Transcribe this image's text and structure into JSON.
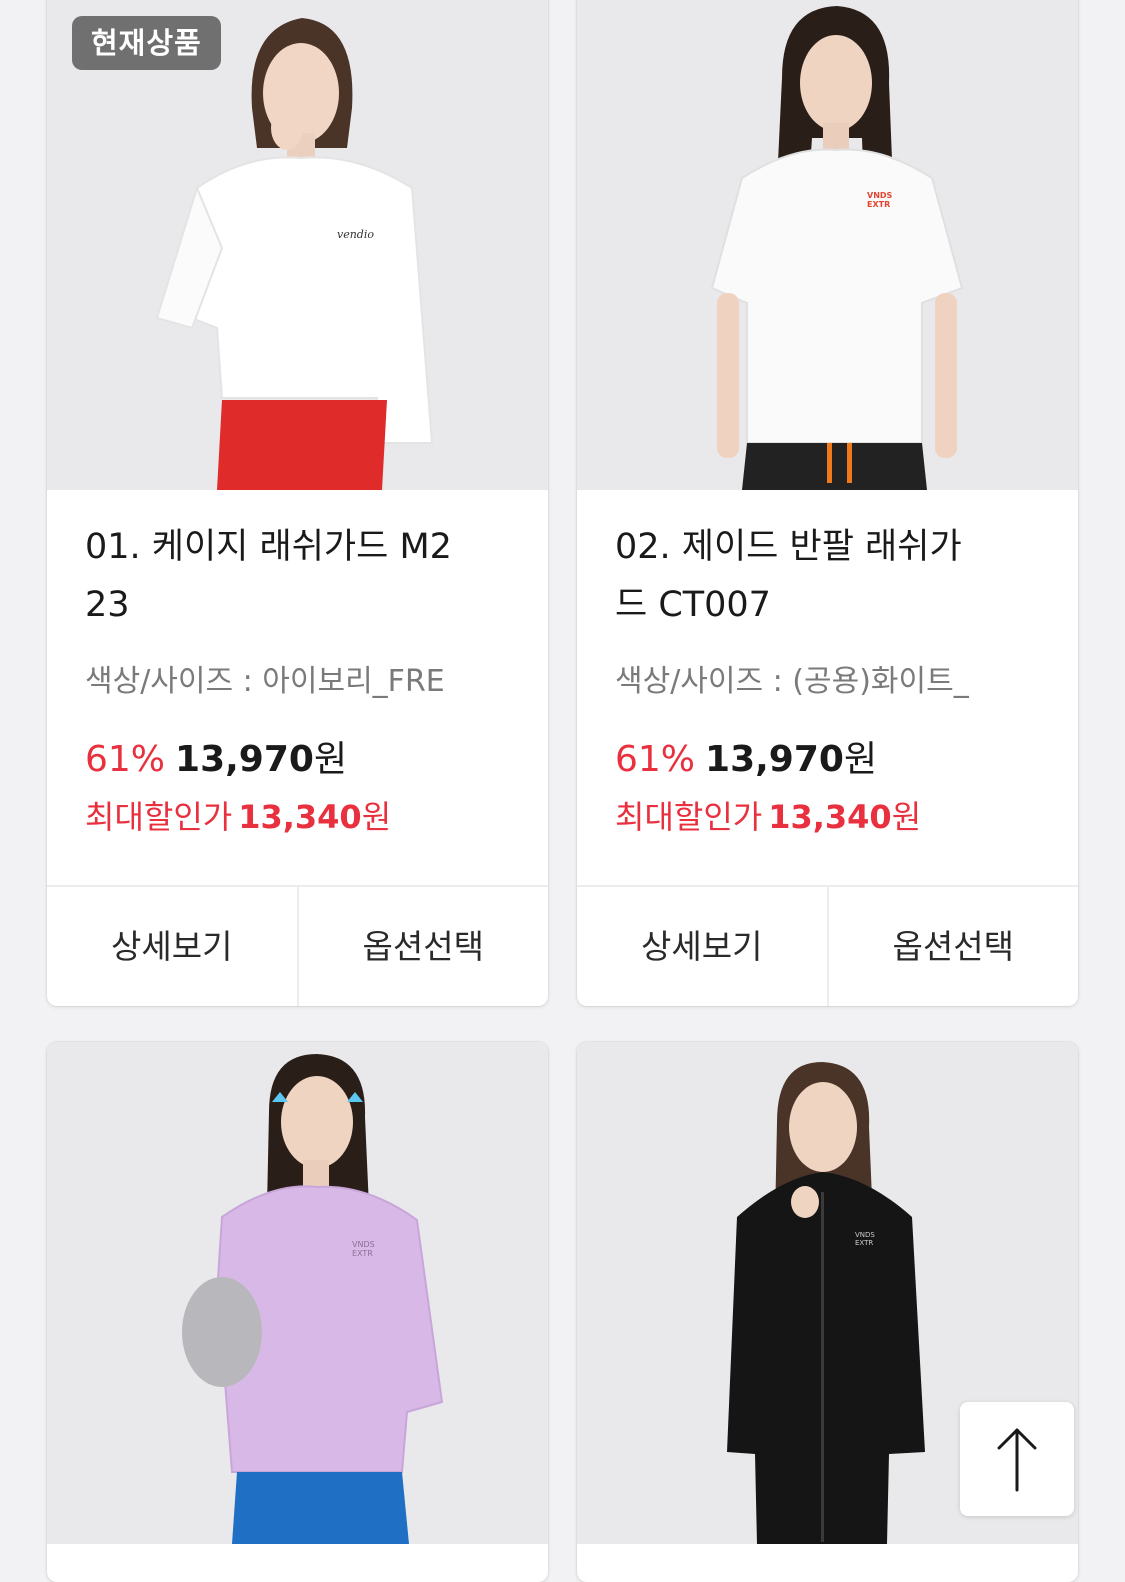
{
  "products": [
    {
      "badge": "현재상품",
      "title_line1": "01. 케이지 래쉬가드 M2",
      "title_line2": "23",
      "option": "색상/사이즈 : 아이보리_FRE",
      "discount": "61%",
      "price": "13,970",
      "currency": "원",
      "max_label": "최대할인가",
      "max_price": "13,340",
      "detail_button": "상세보기",
      "option_button": "옵션선택",
      "shirt_color": "#ffffff",
      "bottom_color": "#e02b2b"
    },
    {
      "title_line1": "02. 제이드 반팔 래쉬가",
      "title_line2": "드 CT007",
      "option": "색상/사이즈 : (공용)화이트_",
      "discount": "61%",
      "price": "13,970",
      "currency": "원",
      "max_label": "최대할인가",
      "max_price": "13,340",
      "detail_button": "상세보기",
      "option_button": "옵션선택",
      "shirt_color": "#fafafa",
      "bottom_color": "#222222"
    },
    {
      "shirt_color": "#d8b8e6",
      "bottom_color": "#1f6fc4"
    },
    {
      "shirt_color": "#151515",
      "bottom_color": "#151515"
    }
  ],
  "colors": {
    "accent_red": "#e8303e",
    "badge_bg": "#707070"
  },
  "icons": {
    "top": "arrow-up-icon"
  }
}
